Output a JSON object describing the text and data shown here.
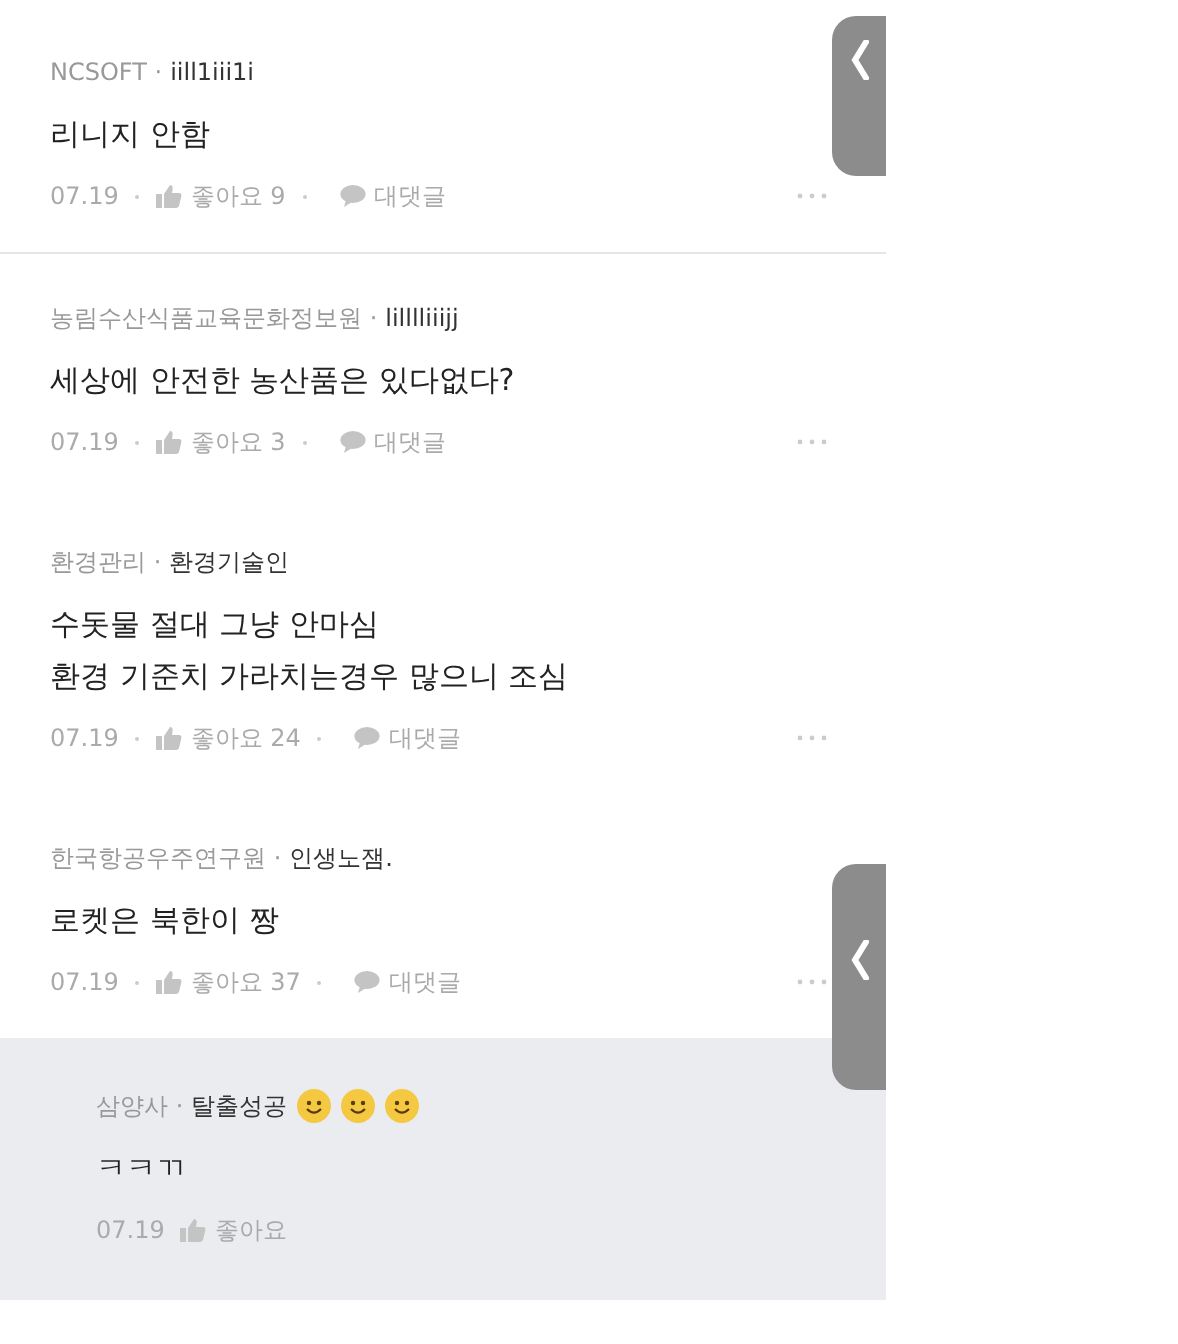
{
  "comments": [
    {
      "kind": "comment",
      "author": "NCSOFT ·",
      "nickname": "iill1iii1i",
      "body": [
        "리니지 안함"
      ],
      "date": "07.19",
      "likes": "좋아요 9",
      "reply": "대댓글",
      "divider_below": true
    },
    {
      "kind": "comment",
      "author": "농림수산식품교육문화정보원 ·",
      "nickname": "lilllliiijj",
      "body": [
        "세상에 안전한 농산품은 있다없다?"
      ],
      "date": "07.19",
      "likes": "좋아요 3",
      "reply": "대댓글",
      "divider_below": false
    },
    {
      "kind": "comment",
      "author": "환경관리 ·",
      "nickname": "환경기술인",
      "body": [
        "수돗물 절대 그냥 안마심",
        "환경 기준치 가라치는경우 많으니 조심"
      ],
      "date": "07.19",
      "likes": "좋아요 24",
      "reply": "대댓글",
      "divider_below": false
    },
    {
      "kind": "comment",
      "author": "한국항공우주연구원 ·",
      "nickname": "인생노잼.",
      "body": [
        "로켓은 북한이 짱"
      ],
      "date": "07.19",
      "likes": "좋아요 37",
      "reply": "대댓글",
      "divider_below": false
    },
    {
      "kind": "reply",
      "author": "삼양사 ·",
      "nickname": "탈출성공",
      "body": [
        "ㅋㅋㄲ"
      ],
      "date": "07.19",
      "likes": "좋아요",
      "divider_below": false
    }
  ]
}
